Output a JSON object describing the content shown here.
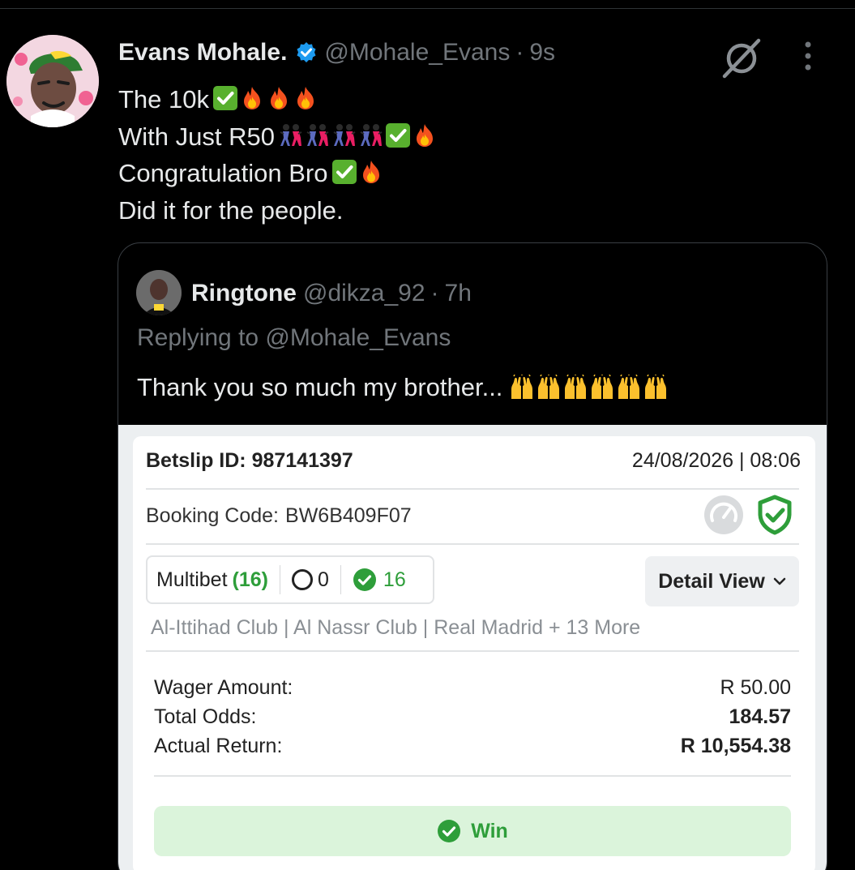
{
  "tweet": {
    "author_name": "Evans Mohale.",
    "handle": "@Mohale_Evans",
    "separator": "·",
    "time": "9s",
    "lines": [
      {
        "text": "The 10k",
        "emojis": [
          "check-mark-emoji",
          "fire-emoji",
          "fire-emoji",
          "fire-emoji"
        ]
      },
      {
        "text": "With Just R50",
        "emojis": [
          "dancers-emoji",
          "dancers-emoji",
          "dancers-emoji",
          "dancers-emoji",
          "check-mark-emoji",
          "fire-emoji"
        ]
      },
      {
        "text": "Congratulation Bro",
        "emojis": [
          "check-mark-emoji",
          "fire-emoji"
        ]
      },
      {
        "text": "Did it for the people.",
        "emojis": []
      }
    ]
  },
  "quote": {
    "author_name": "Ringtone",
    "handle": "@dikza_92",
    "separator": "·",
    "time": "7h",
    "replying_to": "Replying to @Mohale_Evans",
    "text": "Thank you so much my brother...",
    "emojis": [
      "raised-hands-emoji",
      "raised-hands-emoji",
      "raised-hands-emoji",
      "raised-hands-emoji",
      "raised-hands-emoji",
      "raised-hands-emoji"
    ]
  },
  "betslip": {
    "id_label": "Betslip ID: 987141397",
    "datetime": "24/08/2026 | 08:06",
    "booking_label": "Booking Code:",
    "booking_code": "BW6B409F07",
    "multibet_label": "Multibet",
    "multibet_count": "(16)",
    "open_count": "0",
    "won_count": "16",
    "detail_view_label": "Detail View",
    "teams": "Al-Ittihad Club | Al Nassr Club | Real Madrid + 13 More",
    "wager_label": "Wager Amount:",
    "wager_value": "R 50.00",
    "odds_label": "Total Odds:",
    "odds_value": "184.57",
    "return_label": "Actual Return:",
    "return_value": "R 10,554.38",
    "status_label": "Win"
  },
  "colors": {
    "background": "#000000",
    "text_primary": "#e7e9ea",
    "text_secondary": "#71767b",
    "verified_blue": "#1d9bf0",
    "win_green": "#2e9e3a",
    "win_bar_bg": "#dbf4db"
  }
}
